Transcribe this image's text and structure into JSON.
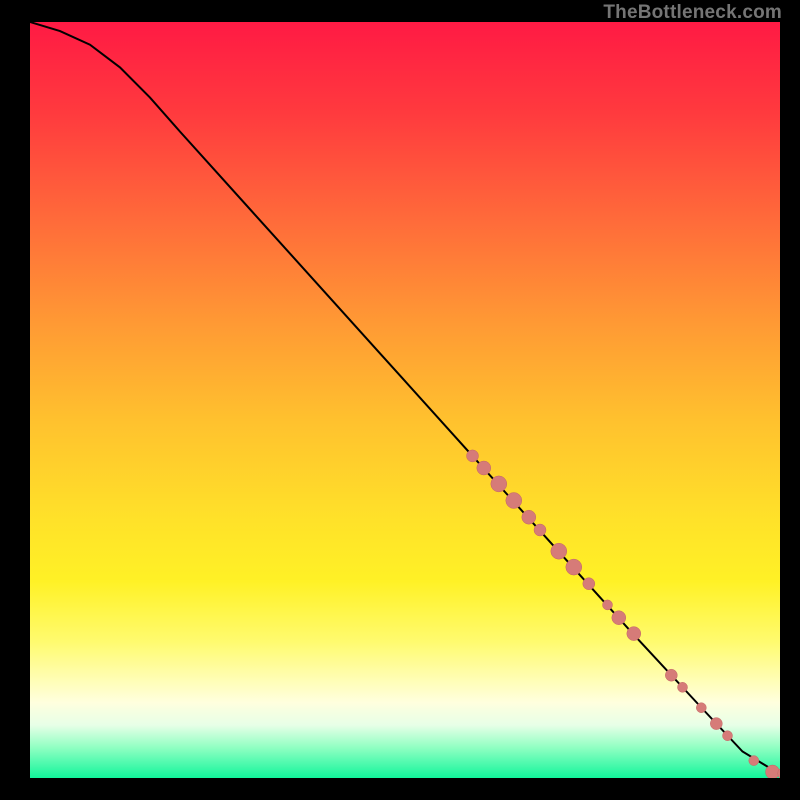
{
  "attribution": "TheBottleneck.com",
  "colors": {
    "background_outer": "#000000",
    "gradient_top": "#ff1a44",
    "gradient_bottom": "#12f59b",
    "curve": "#000000",
    "marker_fill": "#d67b78",
    "marker_stroke": "#c36764"
  },
  "chart_data": {
    "type": "line",
    "title": "",
    "xlabel": "",
    "ylabel": "",
    "xlim": [
      0,
      100
    ],
    "ylim": [
      0,
      100
    ],
    "grid": false,
    "legend": false,
    "curve": [
      {
        "x": 0,
        "y": 100
      },
      {
        "x": 4,
        "y": 98.8
      },
      {
        "x": 8,
        "y": 97
      },
      {
        "x": 12,
        "y": 94
      },
      {
        "x": 16,
        "y": 90
      },
      {
        "x": 20,
        "y": 85.5
      },
      {
        "x": 25,
        "y": 80
      },
      {
        "x": 30,
        "y": 74.5
      },
      {
        "x": 40,
        "y": 63.5
      },
      {
        "x": 50,
        "y": 52.5
      },
      {
        "x": 60,
        "y": 41.5
      },
      {
        "x": 70,
        "y": 30.5
      },
      {
        "x": 80,
        "y": 19.5
      },
      {
        "x": 90,
        "y": 8.8
      },
      {
        "x": 95,
        "y": 3.5
      },
      {
        "x": 100,
        "y": 0.5
      }
    ],
    "markers": [
      {
        "x": 59.0,
        "y": 42.6,
        "r": 6
      },
      {
        "x": 60.5,
        "y": 41.0,
        "r": 7
      },
      {
        "x": 62.5,
        "y": 38.9,
        "r": 8
      },
      {
        "x": 64.5,
        "y": 36.7,
        "r": 8
      },
      {
        "x": 66.5,
        "y": 34.5,
        "r": 7
      },
      {
        "x": 68.0,
        "y": 32.8,
        "r": 6
      },
      {
        "x": 70.5,
        "y": 30.0,
        "r": 8
      },
      {
        "x": 72.5,
        "y": 27.9,
        "r": 8
      },
      {
        "x": 74.5,
        "y": 25.7,
        "r": 6
      },
      {
        "x": 77.0,
        "y": 22.9,
        "r": 5
      },
      {
        "x": 78.5,
        "y": 21.2,
        "r": 7
      },
      {
        "x": 80.5,
        "y": 19.1,
        "r": 7
      },
      {
        "x": 85.5,
        "y": 13.6,
        "r": 6
      },
      {
        "x": 87.0,
        "y": 12.0,
        "r": 5
      },
      {
        "x": 89.5,
        "y": 9.3,
        "r": 5
      },
      {
        "x": 91.5,
        "y": 7.2,
        "r": 6
      },
      {
        "x": 93.0,
        "y": 5.6,
        "r": 5
      },
      {
        "x": 96.5,
        "y": 2.3,
        "r": 5
      },
      {
        "x": 99.0,
        "y": 0.8,
        "r": 7
      },
      {
        "x": 100.5,
        "y": 0.6,
        "r": 6
      }
    ]
  }
}
